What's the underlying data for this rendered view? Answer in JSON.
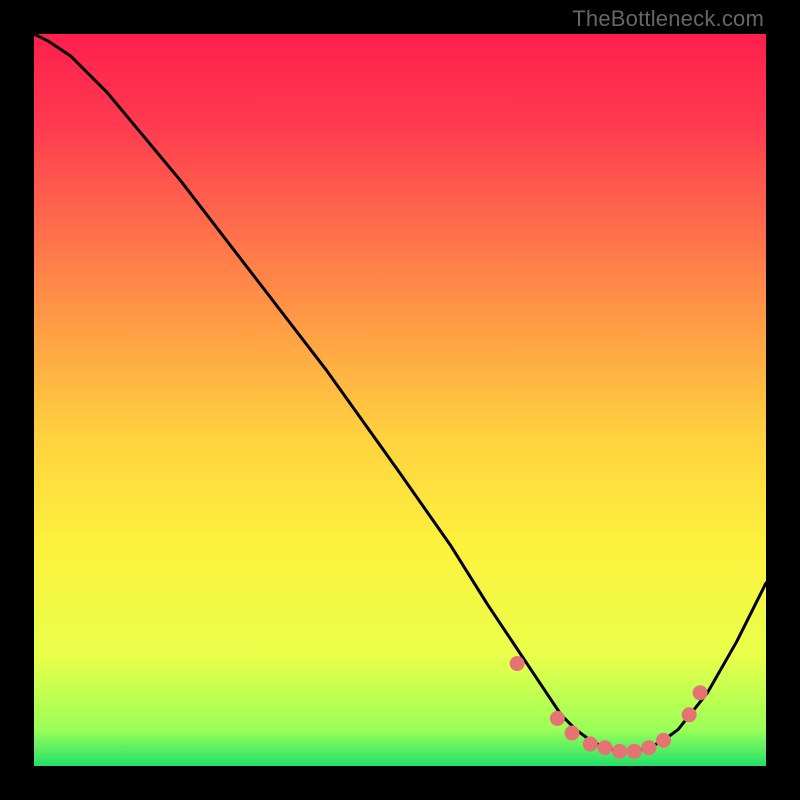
{
  "watermark": "TheBottleneck.com",
  "chart_data": {
    "type": "line",
    "title": "",
    "xlabel": "",
    "ylabel": "",
    "xlim": [
      0,
      100
    ],
    "ylim": [
      0,
      100
    ],
    "grid": false,
    "gradient_fill": {
      "stops": [
        {
          "offset": 0,
          "color": "#ff1f4b"
        },
        {
          "offset": 12,
          "color": "#ff3950"
        },
        {
          "offset": 30,
          "color": "#ff7a4a"
        },
        {
          "offset": 55,
          "color": "#ffd23e"
        },
        {
          "offset": 70,
          "color": "#fcf23d"
        },
        {
          "offset": 85,
          "color": "#e9ff4a"
        },
        {
          "offset": 95,
          "color": "#9bff58"
        },
        {
          "offset": 100,
          "color": "#23e06a"
        }
      ]
    },
    "series": [
      {
        "name": "bottleneck-curve",
        "type": "line",
        "color": "#000000",
        "x": [
          0,
          2,
          5,
          10,
          20,
          30,
          40,
          50,
          57,
          62,
          66,
          70,
          72,
          74,
          76,
          78,
          80,
          82,
          84,
          86,
          88,
          92,
          96,
          100
        ],
        "y": [
          100,
          99,
          97,
          92,
          80,
          67,
          54,
          40,
          30,
          22,
          16,
          10,
          7,
          5,
          3.5,
          2.5,
          2,
          2,
          2.5,
          3.5,
          5,
          10,
          17,
          25
        ]
      },
      {
        "name": "marker-dots",
        "type": "scatter",
        "color": "#e57373",
        "x": [
          66,
          71.5,
          73.5,
          76,
          78,
          80,
          82,
          84,
          86,
          89.5,
          91
        ],
        "y": [
          14,
          6.5,
          4.5,
          3,
          2.5,
          2,
          2,
          2.5,
          3.5,
          7,
          10
        ]
      }
    ]
  }
}
